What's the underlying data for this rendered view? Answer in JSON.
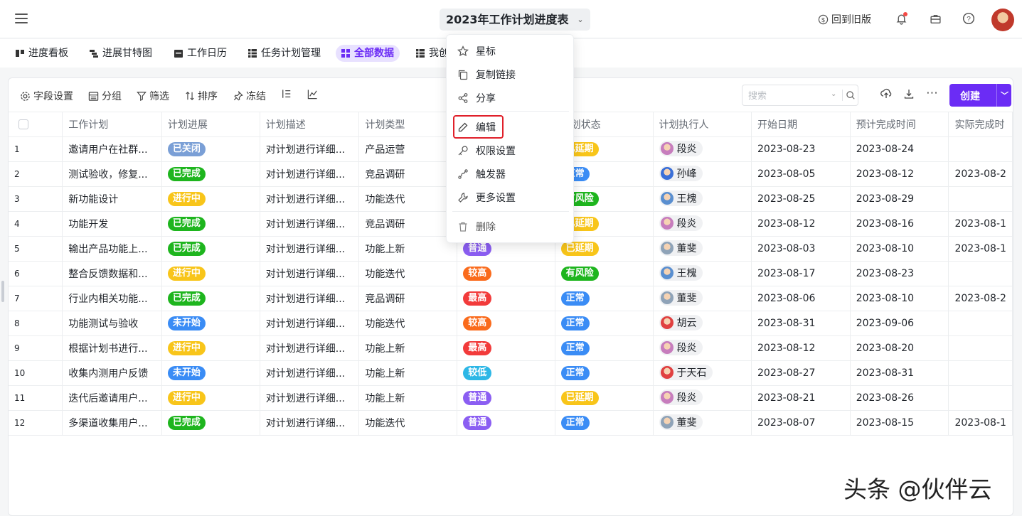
{
  "header": {
    "doc_title": "2023年工作计划进度表",
    "back_old": "回到旧版"
  },
  "tabs": [
    {
      "label": "进度看板",
      "active": false
    },
    {
      "label": "进展甘特图",
      "active": false
    },
    {
      "label": "工作日历",
      "active": false
    },
    {
      "label": "任务计划管理",
      "active": false
    },
    {
      "label": "全部数据",
      "active": true
    },
    {
      "label": "我创",
      "active": false
    }
  ],
  "toolbar": {
    "fields": "字段设置",
    "group": "分组",
    "filter": "筛选",
    "sort": "排序",
    "freeze": "冻结",
    "search_placeholder": "搜索",
    "create": "创建"
  },
  "columns": [
    "工作计划",
    "计划进展",
    "计划描述",
    "计划类型",
    "",
    "计划状态",
    "计划执行人",
    "开始日期",
    "预计完成时间",
    "实际完成时"
  ],
  "colors": {
    "accent": "#6b2cf5",
    "closed": "#7a9fd6",
    "done": "#1eb51e",
    "inprogress": "#f8c51a",
    "notstarted": "#3a8cf5",
    "high": "#fa6b1c",
    "highest": "#f23b3b",
    "normal_prio": "#8b5ef2",
    "low": "#2db7e6",
    "delayed": "#f8c51a",
    "normal_state": "#3a8cf5",
    "risk": "#1eb51e"
  },
  "rows": [
    {
      "n": "1",
      "plan": "邀请用户在社群...",
      "progress": "已关闭",
      "pc": "closed",
      "desc": "对计划进行详细...",
      "type": "产品运营",
      "prio": "",
      "prc": "",
      "state": "已延期",
      "sc": "delayed",
      "person": "段炎",
      "avatar": "#c77dbd",
      "start": "2023-08-23",
      "due": "2023-08-24",
      "actual": ""
    },
    {
      "n": "2",
      "plan": "测试验收，修复...",
      "progress": "已完成",
      "pc": "done",
      "desc": "对计划进行详细...",
      "type": "竞品调研",
      "prio": "",
      "prc": "",
      "state": "正常",
      "sc": "normal_state",
      "person": "孙峰",
      "avatar": "#3a6fd8",
      "start": "2023-08-05",
      "due": "2023-08-12",
      "actual": "2023-08-2"
    },
    {
      "n": "3",
      "plan": "新功能设计",
      "progress": "进行中",
      "pc": "inprogress",
      "desc": "对计划进行详细...",
      "type": "功能迭代",
      "prio": "",
      "prc": "",
      "state": "有风险",
      "sc": "risk",
      "person": "王槐",
      "avatar": "#5a8fd0",
      "start": "2023-08-25",
      "due": "2023-08-29",
      "actual": ""
    },
    {
      "n": "4",
      "plan": "功能开发",
      "progress": "已完成",
      "pc": "done",
      "desc": "对计划进行详细...",
      "type": "竞品调研",
      "prio": "",
      "prc": "",
      "state": "已延期",
      "sc": "delayed",
      "person": "段炎",
      "avatar": "#c77dbd",
      "start": "2023-08-12",
      "due": "2023-08-16",
      "actual": "2023-08-1"
    },
    {
      "n": "5",
      "plan": "输出产品功能上...",
      "progress": "已完成",
      "pc": "done",
      "desc": "对计划进行详细...",
      "type": "功能上新",
      "prio": "普通",
      "prc": "normal_prio",
      "state": "已延期",
      "sc": "delayed",
      "person": "董斐",
      "avatar": "#8fa3b8",
      "start": "2023-08-03",
      "due": "2023-08-10",
      "actual": "2023-08-1"
    },
    {
      "n": "6",
      "plan": "整合反馈数据和...",
      "progress": "进行中",
      "pc": "inprogress",
      "desc": "对计划进行详细...",
      "type": "功能迭代",
      "prio": "较高",
      "prc": "high",
      "state": "有风险",
      "sc": "risk",
      "person": "王槐",
      "avatar": "#5a8fd0",
      "start": "2023-08-17",
      "due": "2023-08-23",
      "actual": ""
    },
    {
      "n": "7",
      "plan": "行业内相关功能...",
      "progress": "已完成",
      "pc": "done",
      "desc": "对计划进行详细...",
      "type": "竞品调研",
      "prio": "最高",
      "prc": "highest",
      "state": "正常",
      "sc": "normal_state",
      "person": "董斐",
      "avatar": "#8fa3b8",
      "start": "2023-08-06",
      "due": "2023-08-10",
      "actual": "2023-08-2"
    },
    {
      "n": "8",
      "plan": "功能测试与验收",
      "progress": "未开始",
      "pc": "notstarted",
      "desc": "对计划进行详细...",
      "type": "功能迭代",
      "prio": "较高",
      "prc": "high",
      "state": "正常",
      "sc": "normal_state",
      "person": "胡云",
      "avatar": "#e04040",
      "start": "2023-08-31",
      "due": "2023-09-06",
      "actual": ""
    },
    {
      "n": "9",
      "plan": "根据计划书进行...",
      "progress": "进行中",
      "pc": "inprogress",
      "desc": "对计划进行详细...",
      "type": "功能上新",
      "prio": "最高",
      "prc": "highest",
      "state": "正常",
      "sc": "normal_state",
      "person": "段炎",
      "avatar": "#c77dbd",
      "start": "2023-08-12",
      "due": "2023-08-20",
      "actual": ""
    },
    {
      "n": "10",
      "plan": "收集内测用户反馈",
      "progress": "未开始",
      "pc": "notstarted",
      "desc": "对计划进行详细...",
      "type": "功能上新",
      "prio": "较低",
      "prc": "low",
      "state": "正常",
      "sc": "normal_state",
      "person": "于天石",
      "avatar": "#e04040",
      "start": "2023-08-27",
      "due": "2023-08-31",
      "actual": ""
    },
    {
      "n": "11",
      "plan": "迭代后邀请用户...",
      "progress": "进行中",
      "pc": "inprogress",
      "desc": "对计划进行详细...",
      "type": "功能上新",
      "prio": "普通",
      "prc": "normal_prio",
      "state": "已延期",
      "sc": "delayed",
      "person": "段炎",
      "avatar": "#c77dbd",
      "start": "2023-08-21",
      "due": "2023-08-26",
      "actual": ""
    },
    {
      "n": "12",
      "plan": "多渠道收集用户...",
      "progress": "已完成",
      "pc": "done",
      "desc": "对计划进行详细...",
      "type": "功能迭代",
      "prio": "普通",
      "prc": "normal_prio",
      "state": "正常",
      "sc": "normal_state",
      "person": "董斐",
      "avatar": "#8fa3b8",
      "start": "2023-08-07",
      "due": "2023-08-15",
      "actual": "2023-08-1"
    }
  ],
  "menu": {
    "star": "星标",
    "copy_link": "复制链接",
    "share": "分享",
    "edit": "编辑",
    "permissions": "权限设置",
    "trigger": "触发器",
    "more_settings": "更多设置",
    "delete": "删除"
  },
  "watermark": "头条 @伙伴云"
}
